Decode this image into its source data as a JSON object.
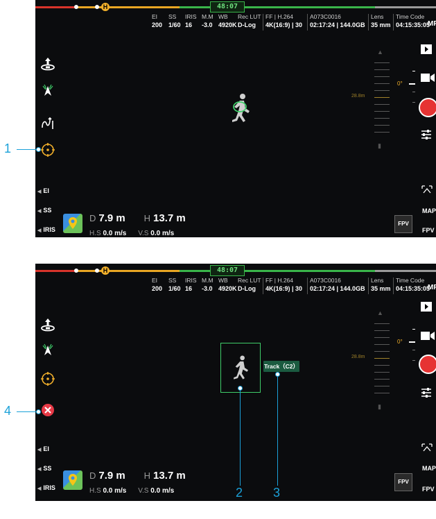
{
  "status_bar": {
    "timer": "48:07",
    "home_marker": "H"
  },
  "camera_params": [
    {
      "label": "EI",
      "value": "200"
    },
    {
      "label": "SS",
      "value": "1/60"
    },
    {
      "label": "IRIS",
      "value": "16"
    },
    {
      "label": "M.M",
      "value": "-3.0"
    },
    {
      "label": "WB",
      "value": "4920K"
    },
    {
      "label": "Rec LUT",
      "value": "D-Log"
    },
    {
      "label": "FF | H.264",
      "value": "4K(16:9) | 30"
    },
    {
      "label": "A073C0016",
      "value": "02:17:24 | 144.0GB"
    },
    {
      "label": "Lens",
      "value": "35 mm"
    },
    {
      "label": "Time Code",
      "value": "04:15:35:05"
    }
  ],
  "mf_label": "MF",
  "ae_label": "AE",
  "gimbal_angle": "0°",
  "altitude_scale_label": "28.8m",
  "side_labels": {
    "ei": "EI",
    "ss": "SS",
    "iris": "IRIS"
  },
  "telemetry": {
    "d_prefix": "D",
    "d_value": "7.9 m",
    "h_prefix": "H",
    "h_value": "13.7 m",
    "hs_prefix": "H.S",
    "hs_value": "0.0 m/s",
    "vs_prefix": "V.S",
    "vs_value": "0.0 m/s"
  },
  "fpv_box": "FPV",
  "map_label": "MAP",
  "fpv_label": "FPV",
  "track_label": "Track（C2）",
  "callouts": {
    "c1": "1",
    "c2": "2",
    "c3": "3",
    "c4": "4"
  },
  "colors": {
    "accent_green": "#3fce6a",
    "callout_blue": "#1ba1d9",
    "record_red": "#e63333",
    "focus_yellow": "#f2b02b",
    "cancel_red": "#e63946"
  }
}
